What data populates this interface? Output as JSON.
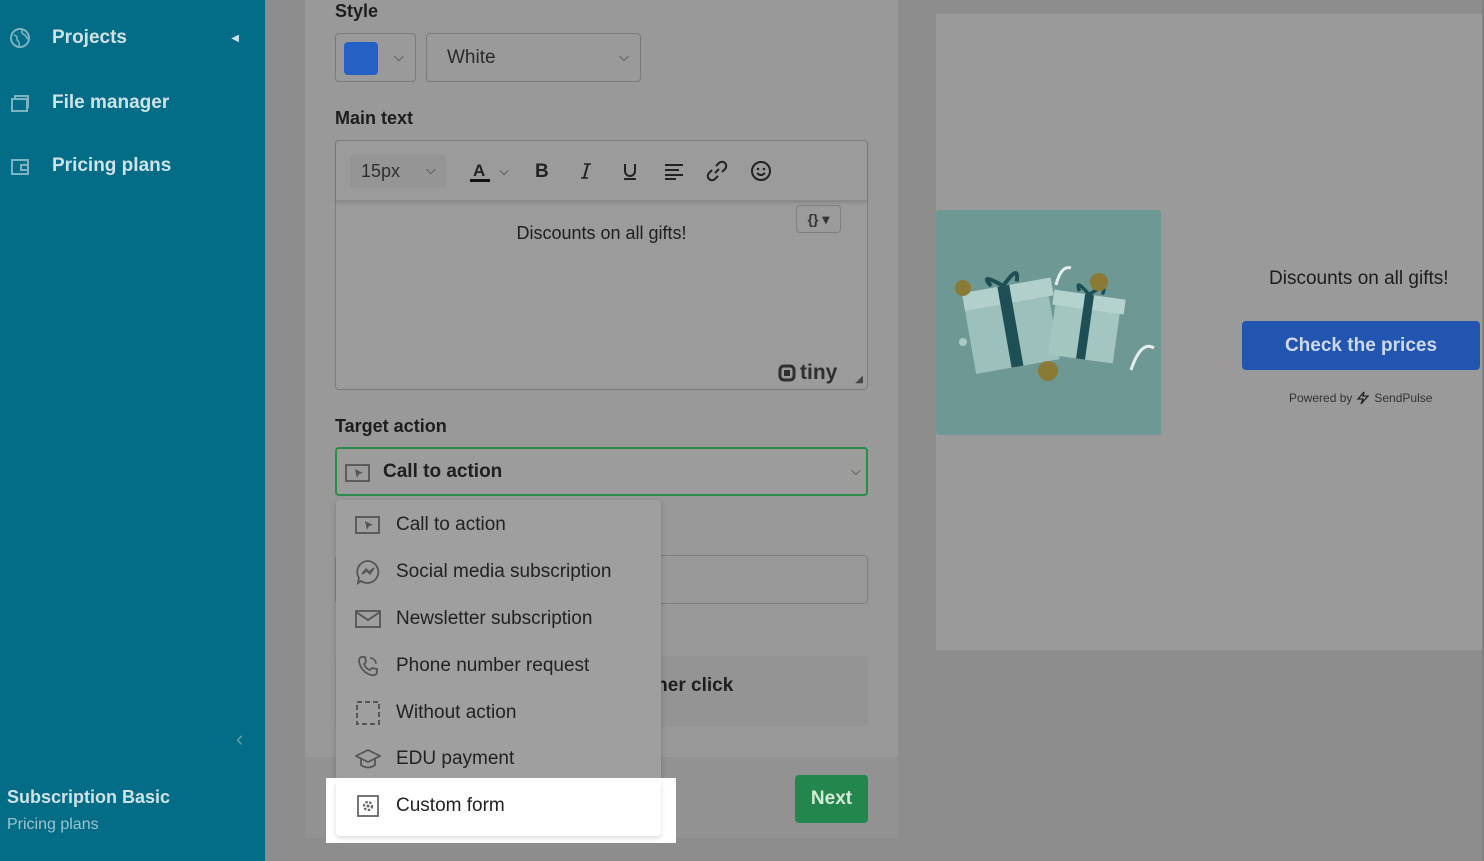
{
  "sidebar": {
    "items": [
      {
        "label": "Projects",
        "icon": "globe-icon"
      },
      {
        "label": "File manager",
        "icon": "folders-icon"
      },
      {
        "label": "Pricing plans",
        "icon": "wallet-icon"
      }
    ],
    "subscription_title": "Subscription Basic",
    "subscription_sub": "Pricing plans"
  },
  "form": {
    "style_label": "Style",
    "style_color": "#2561c4",
    "theme_value": "White",
    "main_text_label": "Main text",
    "font_size": "15px",
    "editor_content": "Discounts on all gifts!",
    "code_button": "{}",
    "tiny_brand": "tiny",
    "target_label": "Target action",
    "target_value": "Call to action",
    "voucher_text": "ncher click",
    "next_label": "Next"
  },
  "dropdown": {
    "options": [
      {
        "label": "Call to action",
        "icon": "cursor-icon"
      },
      {
        "label": "Social media subscription",
        "icon": "messenger-icon"
      },
      {
        "label": "Newsletter subscription",
        "icon": "mail-icon"
      },
      {
        "label": "Phone number request",
        "icon": "phone-icon"
      },
      {
        "label": "Without action",
        "icon": "dashed-square-icon"
      },
      {
        "label": "EDU payment",
        "icon": "graduation-cap-icon"
      },
      {
        "label": "Custom form",
        "icon": "gear-form-icon"
      }
    ]
  },
  "preview": {
    "text": "Discounts on all gifts!",
    "button_label": "Check the prices",
    "powered_prefix": "Powered by",
    "powered_brand": "SendPulse"
  },
  "colors": {
    "sidebar": "#036c86",
    "accent_green": "#23864c",
    "cta_blue": "#2155b0"
  }
}
